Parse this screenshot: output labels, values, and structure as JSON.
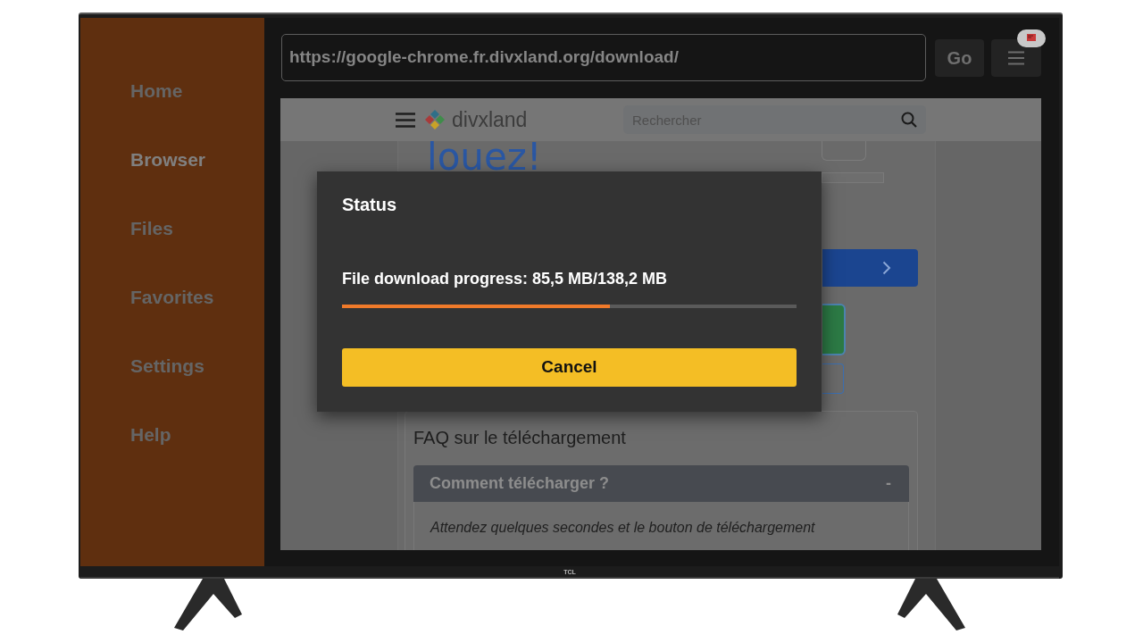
{
  "sidebar": {
    "items": [
      {
        "label": "Home",
        "selected": false
      },
      {
        "label": "Browser",
        "selected": true
      },
      {
        "label": "Files",
        "selected": false
      },
      {
        "label": "Favorites",
        "selected": false
      },
      {
        "label": "Settings",
        "selected": false
      },
      {
        "label": "Help",
        "selected": false
      }
    ]
  },
  "toolbar": {
    "url": "https://google-chrome.fr.divxland.org/download/",
    "go_button": "Go"
  },
  "web_page": {
    "logo": "divxland",
    "search": {
      "placeholder": "Rechercher"
    },
    "headline": "louez!",
    "faq": {
      "title": "FAQ sur le téléchargement",
      "items": [
        {
          "question": "Comment télécharger ?",
          "toggle": "-",
          "expanded": true,
          "answer": "Attendez quelques secondes et le bouton de téléchargement"
        }
      ]
    }
  },
  "dialog": {
    "title": "Status",
    "message": "File download progress: 85,5 MB/138,2 MB",
    "level": 0.59,
    "button": "Cancel"
  },
  "tv": {
    "brand": "TCL"
  }
}
